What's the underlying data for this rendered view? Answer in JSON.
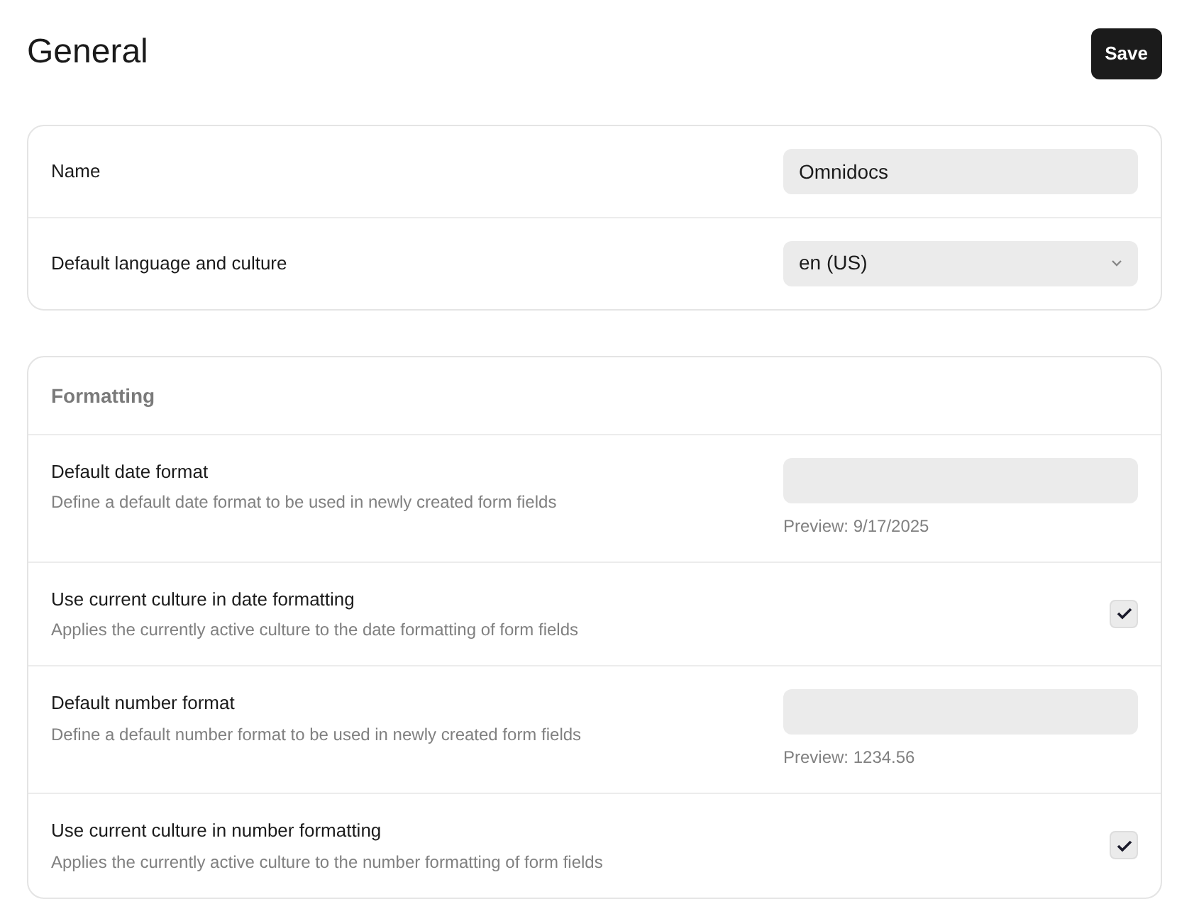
{
  "page": {
    "title": "General",
    "save_button": "Save"
  },
  "sections": [
    {
      "rows": [
        {
          "kind": "text",
          "label": "Name",
          "value": "Omnidocs"
        },
        {
          "kind": "select",
          "label": "Default language and culture",
          "value": "en (US)"
        }
      ]
    },
    {
      "heading": "Formatting",
      "rows": [
        {
          "kind": "text",
          "label": "Default date format",
          "description": "Define a default date format to be used in newly created form fields",
          "value": "",
          "preview": "Preview: 9/17/2025"
        },
        {
          "kind": "checkbox",
          "label": "Use current culture in date formatting",
          "description": "Applies the currently active culture to the date formatting of form fields",
          "checked": true
        },
        {
          "kind": "text",
          "label": "Default number format",
          "description": "Define a default number format to be used in newly created form fields",
          "value": "",
          "preview": "Preview: 1234.56"
        },
        {
          "kind": "checkbox",
          "label": "Use current culture in number formatting",
          "description": "Applies the currently active culture to the number formatting of form fields",
          "checked": true
        }
      ]
    }
  ]
}
